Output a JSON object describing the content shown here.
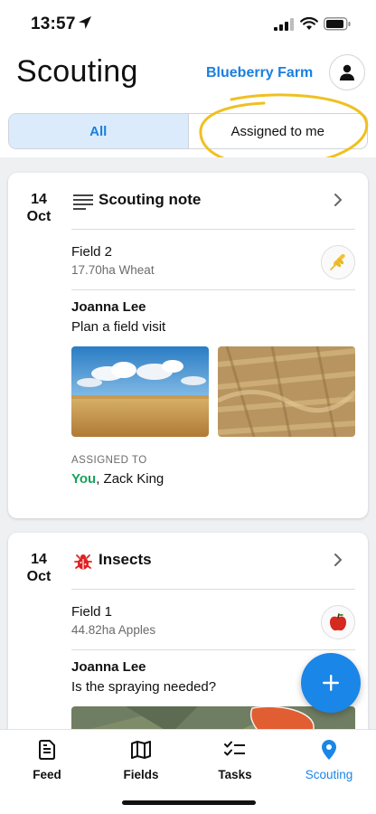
{
  "status_bar": {
    "time": "13:57",
    "icons": [
      "location-arrow-icon",
      "signal-icon",
      "wifi-icon",
      "battery-icon"
    ]
  },
  "header": {
    "title": "Scouting",
    "farm_name": "Blueberry Farm",
    "profile_icon": "user-icon"
  },
  "filter": {
    "options": [
      "All",
      "Assigned to me"
    ],
    "selected": "All",
    "highlight_color": "#f0c020"
  },
  "notes": [
    {
      "date_day": "14",
      "date_month": "Oct",
      "type_label": "Scouting note",
      "type_icon": "notes-lines-icon",
      "field_name": "Field 2",
      "field_details": "17.70ha Wheat",
      "crop_icon": "wheat-icon",
      "author": "Joanna Lee",
      "text": "Plan a field visit",
      "photos": [
        "wheat-field-sky-photo",
        "flattened-wheat-photo"
      ],
      "assigned_label": "ASSIGNED TO",
      "assigned_you": "You",
      "assigned_others": ", Zack King"
    },
    {
      "date_day": "14",
      "date_month": "Oct",
      "type_label": "Insects",
      "type_icon": "bug-icon",
      "field_name": "Field 1",
      "field_details": "44.82ha Apples",
      "crop_icon": "apple-icon",
      "author": "Joanna Lee",
      "text": "Is the spraying needed?",
      "photos": [
        "satellite-map-photo"
      ]
    }
  ],
  "fab_icon": "plus-icon",
  "tabbar": {
    "tabs": [
      {
        "label": "Feed",
        "icon": "feed-doc-icon"
      },
      {
        "label": "Fields",
        "icon": "map-icon"
      },
      {
        "label": "Tasks",
        "icon": "checklist-icon"
      },
      {
        "label": "Scouting",
        "icon": "location-pin-icon"
      }
    ],
    "active": "Scouting"
  },
  "colors": {
    "accent": "#1a86e8",
    "you_green": "#1aa05a",
    "insect_red": "#e02020",
    "highlight_yellow": "#f0c020"
  }
}
